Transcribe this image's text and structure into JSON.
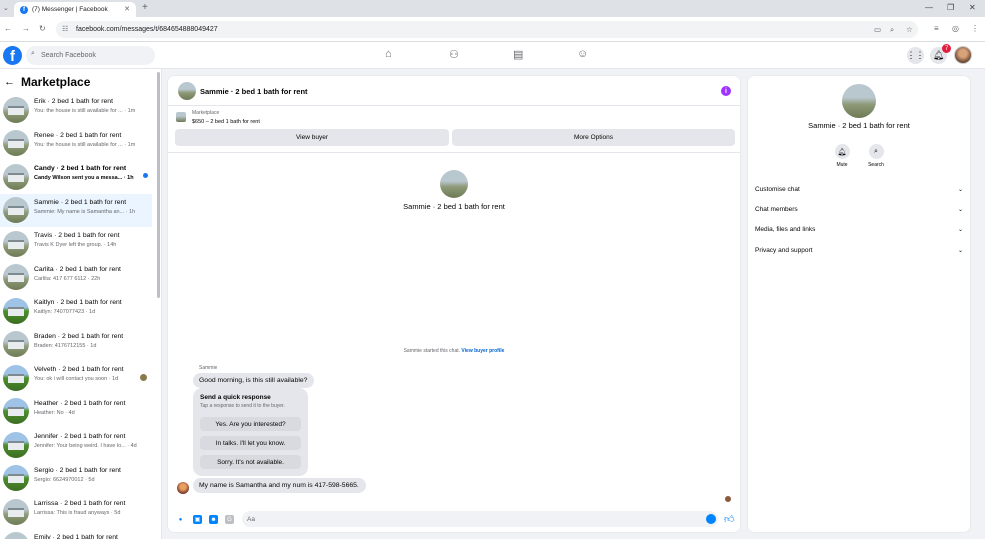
{
  "browser": {
    "tab_title": "(7) Messenger | Facebook",
    "url": "facebook.com/messages/t/6846548880494​27"
  },
  "fb": {
    "search_placeholder": "Search Facebook",
    "notification_count": "7"
  },
  "sidebar": {
    "title": "Marketplace",
    "conversations": [
      {
        "name": "Erik · 2 bed 1 bath for rent",
        "preview": "You: the house is still available for ... · 1m",
        "unread": false
      },
      {
        "name": "Renee · 2 bed 1 bath for rent",
        "preview": "You: the house is still available for ... · 1m",
        "unread": false
      },
      {
        "name": "Candy · 2 bed 1 bath for rent",
        "preview": "Candy Wilson sent you a messa... · 1h",
        "unread": true
      },
      {
        "name": "Sammie · 2 bed 1 bath for rent",
        "preview": "Sammie: My name is Samantha an... · 1h",
        "unread": false
      },
      {
        "name": "Travis · 2 bed 1 bath for rent",
        "preview": "Travis K Dyer left the group. · 14h",
        "unread": false
      },
      {
        "name": "Carlita · 2 bed 1 bath for rent",
        "preview": "Carlita: 417 677 6112 · 22h",
        "unread": false
      },
      {
        "name": "Kaitlyn · 2 bed 1 bath for rent",
        "preview": "Kaitlyn: 7407077423 · 1d",
        "unread": false
      },
      {
        "name": "Braden · 2 bed 1 bath for rent",
        "preview": "Braden: 4176712155 · 1d",
        "unread": false
      },
      {
        "name": "Velveth · 2 bed 1 bath for rent",
        "preview": "You: ok i will contact you soon · 1d",
        "unread": false
      },
      {
        "name": "Heather · 2 bed 1 bath for rent",
        "preview": "Heather: No · 4d",
        "unread": false
      },
      {
        "name": "Jennifer · 2 bed 1 bath for rent",
        "preview": "Jennifer: Your being weird. I have lo... · 4d",
        "unread": false
      },
      {
        "name": "Sergio · 2 bed 1 bath for rent",
        "preview": "Sergio: 6624970012 · 5d",
        "unread": false
      },
      {
        "name": "Larrissa · 2 bed 1 bath for rent",
        "preview": "Larrissa: This is fraud anyways · 5d",
        "unread": false
      },
      {
        "name": "Emily · 2 bed 1 bath for rent",
        "preview": "",
        "unread": false
      }
    ]
  },
  "chat": {
    "title": "Sammie · 2 bed 1 bath for rent",
    "listing_label": "Marketplace",
    "listing_price": "$650 – 2 bed 1 bath for rent",
    "view_buyer": "View buyer",
    "more_options": "More Options",
    "profile_name": "Sammie · 2 bed 1 bath for rent",
    "started_text": "Sammie started this chat.",
    "view_buyer_profile": "View buyer profile",
    "sender_name": "Sammie",
    "message_1": "Good morning, is this still available?",
    "quick_title": "Send a quick response",
    "quick_sub": "Tap a response to send it to the buyer.",
    "quick_responses": [
      "Yes. Are you interested?",
      "In talks. I'll let you know.",
      "Sorry. It's not available."
    ],
    "message_2": "My name is Samantha and my num is 417-598-5665.",
    "composer_placeholder": "Aa"
  },
  "details": {
    "name": "Sammie · 2 bed 1 bath for rent",
    "mute": "Mute",
    "search": "Search",
    "sections": [
      "Customise chat",
      "Chat members",
      "Media, files and links",
      "Privacy and support"
    ]
  },
  "colors": {
    "accent": "#1877f2",
    "messenger_blue": "#0084ff",
    "active_row": "#ebf5ff"
  }
}
